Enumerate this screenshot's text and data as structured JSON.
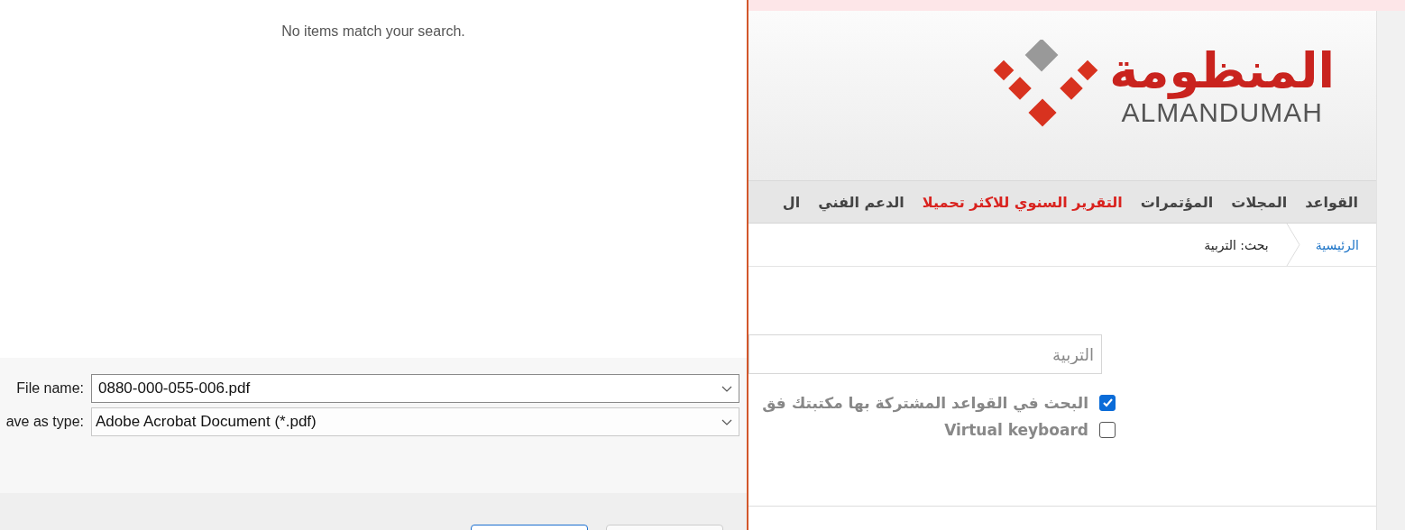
{
  "save_dialog": {
    "empty_message": "No items match your search.",
    "fields": [
      {
        "label": "File name:",
        "value": "0880-000-055-006.pdf",
        "focused": true
      },
      {
        "label": "ave as type:",
        "value": "Adobe Acrobat Document (*.pdf)",
        "focused": false
      }
    ],
    "buttons": [
      {
        "kind": "primary"
      },
      {
        "kind": "secondary"
      }
    ]
  },
  "site": {
    "logo": {
      "arabic": "المنظومة",
      "latin": "ALMANDUMAH"
    },
    "nav": [
      {
        "label": "القواعد",
        "highlight": false
      },
      {
        "label": "المجلات",
        "highlight": false
      },
      {
        "label": "المؤتمرات",
        "highlight": false
      },
      {
        "label": "التقرير السنوي للاكثر تحميلا",
        "highlight": true
      },
      {
        "label": "الدعم الفني",
        "highlight": false
      },
      {
        "label": "ال",
        "highlight": false
      }
    ],
    "breadcrumb": [
      {
        "label": "الرئيسية",
        "kind": "link"
      },
      {
        "label": "بحث: التربية",
        "kind": "current"
      }
    ],
    "search": {
      "placeholder": "التربية"
    },
    "options": [
      {
        "label": "البحث في القواعد المشتركة بها مكتبتك فق",
        "checked": true
      },
      {
        "label": "Virtual keyboard",
        "checked": false
      }
    ]
  }
}
